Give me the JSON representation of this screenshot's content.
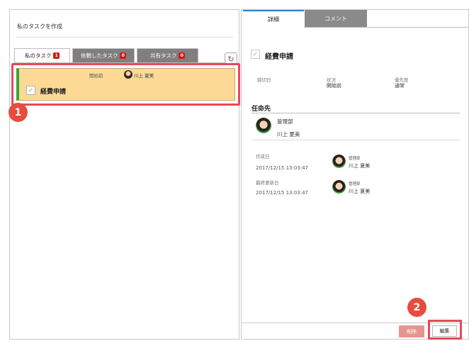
{
  "left": {
    "create_link": "私のタスクを作成",
    "tabs": [
      {
        "label": "私のタスク",
        "count": "1"
      },
      {
        "label": "依頼したタスク",
        "count": "0"
      },
      {
        "label": "共有タスク",
        "count": "0"
      }
    ],
    "refresh_icon": "refresh-icon",
    "task": {
      "status": "開始前",
      "user": "川上 夏美",
      "title": "経費申請"
    }
  },
  "markers": [
    "1",
    "2"
  ],
  "right": {
    "tabs": [
      {
        "label": "詳細"
      },
      {
        "label": "コメント"
      }
    ],
    "title": "経費申請",
    "fields": [
      {
        "label": "締切日",
        "value": ""
      },
      {
        "label": "状況",
        "value": "開始前"
      },
      {
        "label": "優先度",
        "value": "通常"
      }
    ],
    "assignee_section": {
      "title": "任命先",
      "dept": "管理部",
      "name": "川上 夏美"
    },
    "created": {
      "label": "作成日",
      "date": "2017/12/15 13:03:47",
      "dept": "管理部",
      "name": "川上 夏美"
    },
    "updated": {
      "label": "最終更新日",
      "date": "2017/12/15 13:03:47",
      "dept": "管理部",
      "name": "川上 夏美"
    },
    "buttons": {
      "delete": "削除",
      "edit": "編集"
    }
  },
  "colors": {
    "task_card_bg": "#fcd995",
    "task_card_accent": "#3aa53a",
    "badge": "#d01818",
    "highlight": "#e8495a",
    "marker": "#e74c3c",
    "delete_button": "#e5958f"
  }
}
